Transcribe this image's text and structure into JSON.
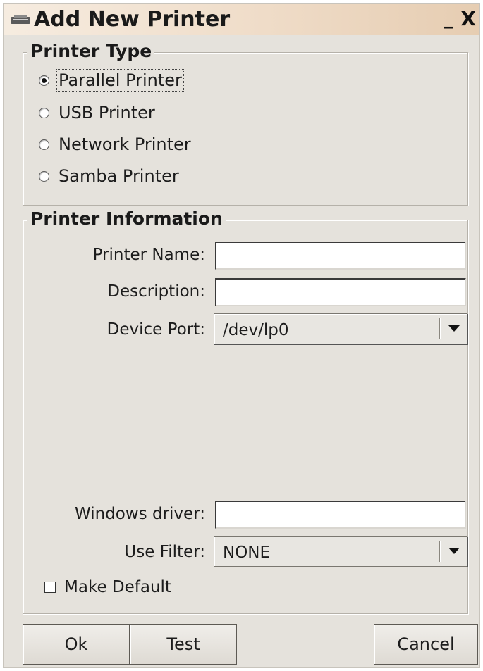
{
  "window": {
    "title": "Add New Printer",
    "minimize_label": "_",
    "close_label": "X"
  },
  "printer_type": {
    "legend": "Printer Type",
    "options": [
      {
        "label": "Parallel Printer",
        "selected": true
      },
      {
        "label": "USB Printer",
        "selected": false
      },
      {
        "label": "Network Printer",
        "selected": false
      },
      {
        "label": "Samba Printer",
        "selected": false
      }
    ]
  },
  "printer_info": {
    "legend": "Printer Information",
    "printer_name": {
      "label": "Printer Name:",
      "value": ""
    },
    "description": {
      "label": "Description:",
      "value": ""
    },
    "device_port": {
      "label": "Device Port:",
      "value": "/dev/lp0"
    },
    "windows_driver": {
      "label": "Windows driver:",
      "value": ""
    },
    "use_filter": {
      "label": "Use Filter:",
      "value": "NONE"
    },
    "make_default": {
      "label": "Make Default",
      "checked": false
    }
  },
  "buttons": {
    "ok": "Ok",
    "test": "Test",
    "cancel": "Cancel"
  },
  "icons": {
    "title": "printer-icon",
    "dropdown": "chevron-down-icon"
  }
}
